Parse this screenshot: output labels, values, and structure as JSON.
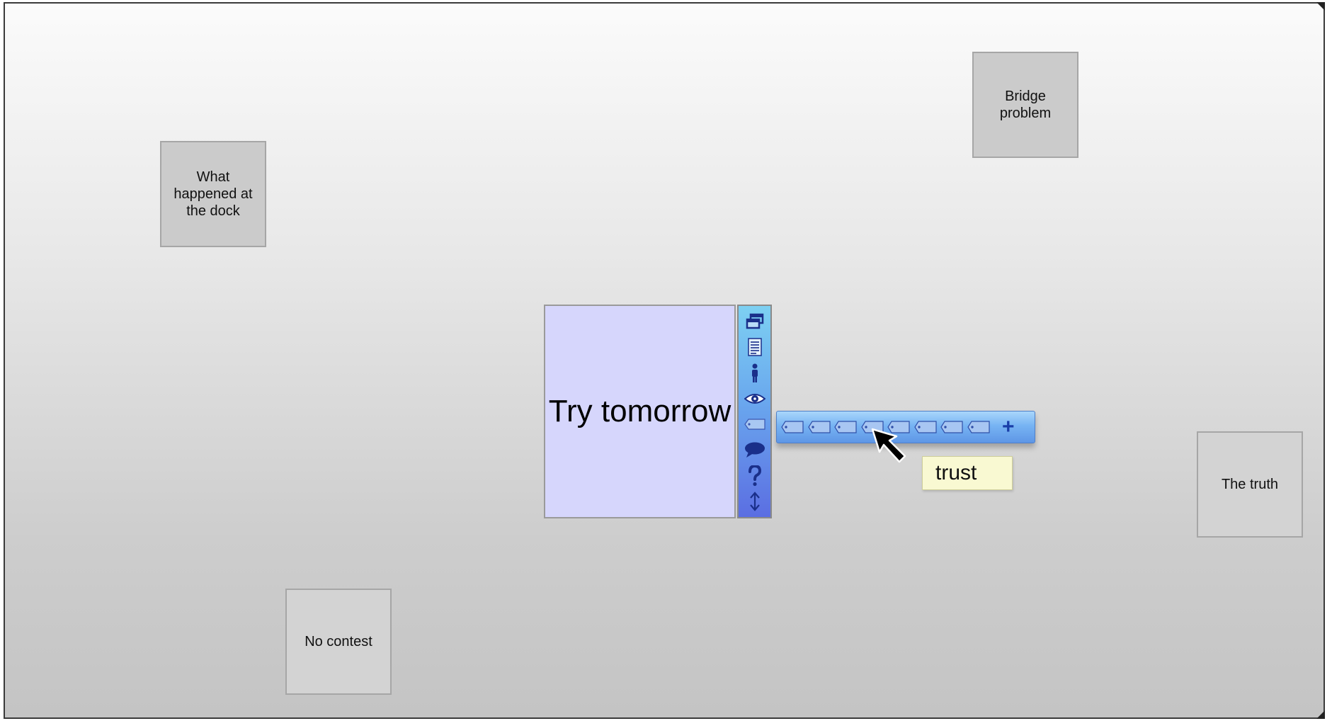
{
  "notes": [
    {
      "id": "dock",
      "text": "What\nhappened at\nthe dock"
    },
    {
      "id": "bridge",
      "text": "Bridge\nproblem"
    },
    {
      "id": "truth",
      "text": "The truth"
    },
    {
      "id": "contest",
      "text": "No contest"
    }
  ],
  "selected_note": {
    "text": "Try tomorrow",
    "color": "#d6d6fc"
  },
  "toolbar": {
    "icons": [
      "window-icon",
      "document-icon",
      "person-icon",
      "eye-icon",
      "tag-icon",
      "speech-bubble-icon",
      "question-icon",
      "resize-vertical-icon"
    ]
  },
  "tag_menu": {
    "tag_count": 8,
    "add_label": "+"
  },
  "tooltip": {
    "text": "trust"
  }
}
